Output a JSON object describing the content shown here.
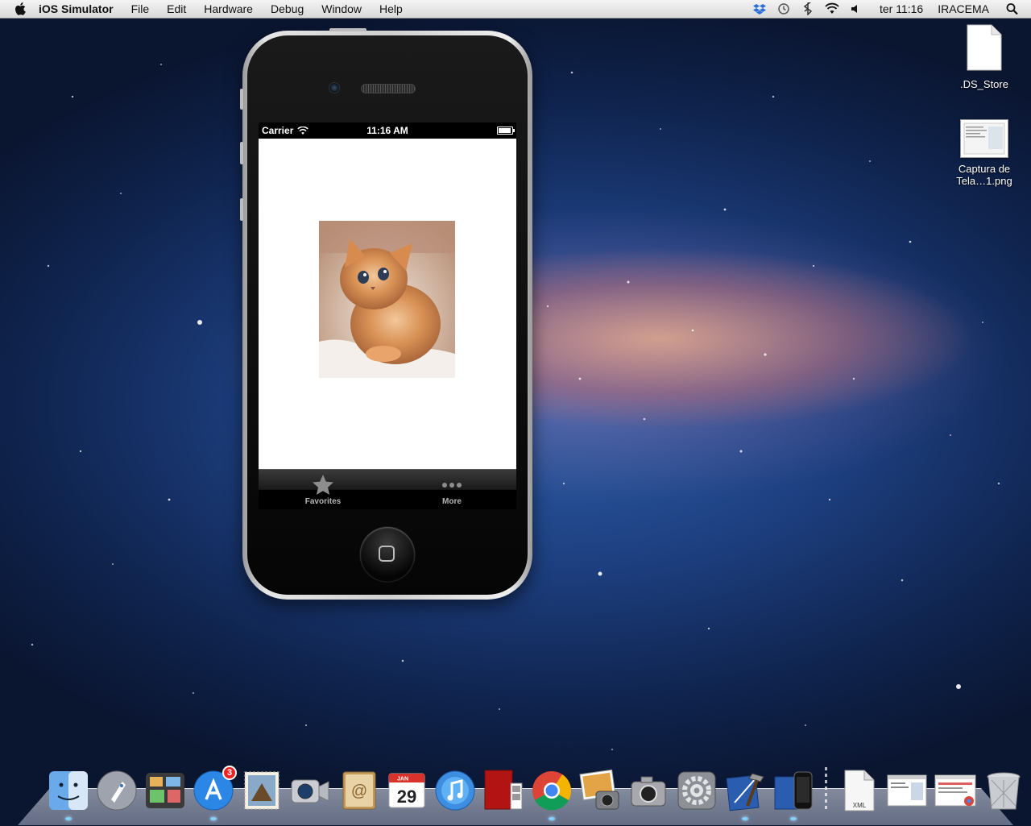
{
  "menubar": {
    "app_name": "iOS Simulator",
    "items": [
      "File",
      "Edit",
      "Hardware",
      "Debug",
      "Window",
      "Help"
    ],
    "clock": "ter 11:16",
    "user": "IRACEMA"
  },
  "desktop": {
    "icons": [
      {
        "label": ".DS_Store",
        "icon": "document-icon"
      },
      {
        "label": "Captura de Tela…1.png",
        "icon": "screenshot-file-icon"
      }
    ]
  },
  "simulator": {
    "statusbar": {
      "carrier": "Carrier",
      "time": "11:16 AM"
    },
    "tabs": [
      {
        "label": "Favorites",
        "icon": "star-icon"
      },
      {
        "label": "More",
        "icon": "more-dots-icon"
      }
    ],
    "image": "kitten-photo"
  },
  "dock": {
    "apps": [
      "Finder",
      "Launchpad",
      "Mission Control",
      "App Store",
      "Mail",
      "FaceTime",
      "Contacts",
      "Calendar",
      "iTunes",
      "Photo Booth",
      "Chrome",
      "iPhoto",
      "Image Capture",
      "System Preferences",
      "Xcode",
      "iOS Simulator"
    ],
    "app_store_badge": "3",
    "calendar_month": "JAN",
    "calendar_day": "29",
    "documents": [
      "XML"
    ]
  }
}
